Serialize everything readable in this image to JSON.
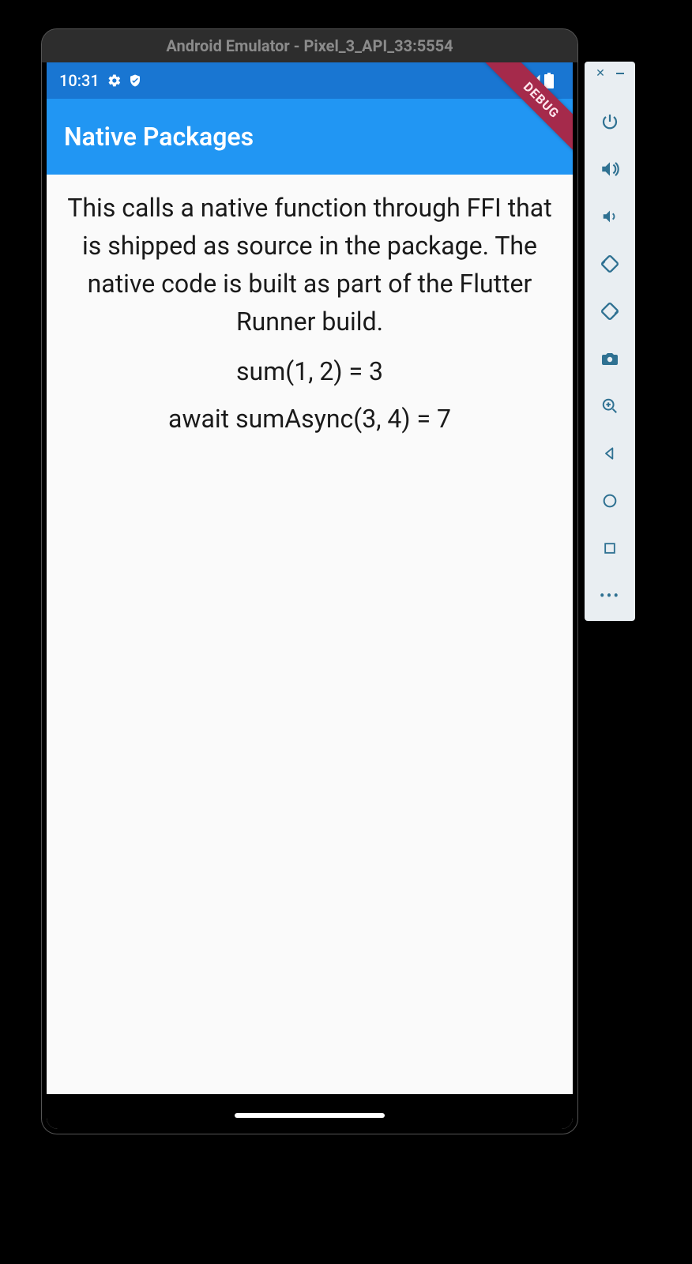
{
  "emulator": {
    "title": "Android Emulator - Pixel_3_API_33:5554",
    "toolbar": {
      "close": "close",
      "minimize": "minimize",
      "buttons": [
        {
          "name": "power-icon"
        },
        {
          "name": "volume-up-icon"
        },
        {
          "name": "volume-down-icon"
        },
        {
          "name": "rotate-left-icon"
        },
        {
          "name": "rotate-right-icon"
        },
        {
          "name": "camera-icon"
        },
        {
          "name": "zoom-in-icon"
        },
        {
          "name": "back-icon"
        },
        {
          "name": "home-icon"
        },
        {
          "name": "overview-icon"
        },
        {
          "name": "more-icon"
        }
      ]
    }
  },
  "statusbar": {
    "time": "10:31",
    "left_icons": [
      "gear-icon",
      "shield-icon"
    ],
    "right_icons": [
      "wifi-icon",
      "cell-signal-icon",
      "battery-icon"
    ]
  },
  "debug_banner": "DEBUG",
  "appbar": {
    "title": "Native Packages"
  },
  "body": {
    "description": "This calls a native function through FFI that is shipped as source in the package. The native code is built as part of the Flutter Runner build.",
    "line1": "sum(1, 2) = 3",
    "line2": "await sumAsync(3, 4) = 7"
  }
}
